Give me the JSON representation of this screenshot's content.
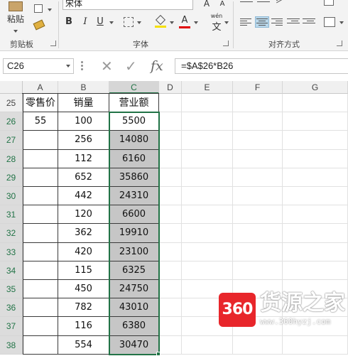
{
  "ribbon": {
    "paste_label": "粘贴",
    "clipboard_label": "剪贴板",
    "font_name": "宋体",
    "font_group_label": "字体",
    "align_group_label": "对齐方式",
    "bold": "B",
    "italic": "I",
    "underline": "U",
    "font_color_glyph": "A",
    "grow_font": "A",
    "shrink_font": "A",
    "wen_glyph": "文",
    "wen_pinyin": "wén"
  },
  "formula_bar": {
    "name_box": "C26",
    "cancel": "✕",
    "confirm": "✓",
    "fx": "fx",
    "formula": "=$A$26*B26"
  },
  "columns": [
    "A",
    "B",
    "C",
    "D",
    "E",
    "F",
    "G"
  ],
  "rows": [
    "25",
    "26",
    "27",
    "28",
    "29",
    "30",
    "31",
    "32",
    "33",
    "34",
    "35",
    "36",
    "37",
    "38"
  ],
  "table": {
    "headers": [
      "零售价",
      "销量",
      "营业额"
    ],
    "price": "55",
    "sales": [
      "100",
      "256",
      "112",
      "652",
      "442",
      "120",
      "362",
      "420",
      "115",
      "450",
      "782",
      "116",
      "554"
    ],
    "revenue": [
      "5500",
      "14080",
      "6160",
      "35860",
      "24310",
      "6600",
      "19910",
      "23100",
      "6325",
      "24750",
      "43010",
      "6380",
      "30470"
    ]
  },
  "watermark": {
    "logo": "360",
    "title": "货源之家",
    "url": "www.360hyzj.com"
  },
  "colors": {
    "accent": "#217346",
    "shade": "#c6c6c6",
    "brand": "#e8262b"
  }
}
